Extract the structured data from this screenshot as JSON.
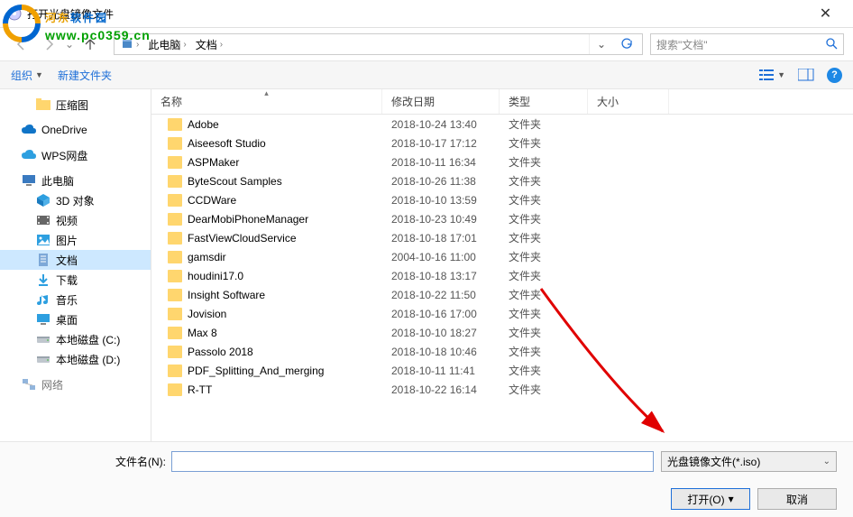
{
  "title": "打开光盘镜像文件",
  "watermark": {
    "text_cn": "河东软件园",
    "url": "www.pc0359.cn"
  },
  "nav": {
    "crumbs": [
      "此电脑",
      "文档"
    ],
    "search_placeholder": "搜索\"文档\""
  },
  "toolbar": {
    "organize": "组织",
    "newfolder": "新建文件夹"
  },
  "sidebar": {
    "top": [
      {
        "label": "压缩图",
        "color": "#ffd66e",
        "ic": "fold"
      }
    ],
    "cloud": [
      {
        "label": "OneDrive",
        "color": "#1074c7",
        "ic": "cloud"
      },
      {
        "label": "WPS网盘",
        "color": "#2d9fe0",
        "ic": "cloud"
      }
    ],
    "pc_label": "此电脑",
    "pc": [
      {
        "label": "3D 对象",
        "color": "#2d9fe0",
        "ic": "cube"
      },
      {
        "label": "视频",
        "color": "#666",
        "ic": "vid"
      },
      {
        "label": "图片",
        "color": "#2d9fe0",
        "ic": "pic"
      },
      {
        "label": "文档",
        "color": "#2d9fe0",
        "ic": "doc",
        "selected": true
      },
      {
        "label": "下载",
        "color": "#2d9fe0",
        "ic": "dl"
      },
      {
        "label": "音乐",
        "color": "#2d9fe0",
        "ic": "mus"
      },
      {
        "label": "桌面",
        "color": "#2d9fe0",
        "ic": "desk"
      },
      {
        "label": "本地磁盘 (C:)",
        "color": "#9aa4ad",
        "ic": "drive"
      },
      {
        "label": "本地磁盘 (D:)",
        "color": "#9aa4ad",
        "ic": "drive"
      }
    ],
    "net_label": "网络"
  },
  "columns": {
    "name": "名称",
    "date": "修改日期",
    "type": "类型",
    "size": "大小"
  },
  "files": [
    {
      "name": "Adobe",
      "date": "2018-10-24 13:40",
      "type": "文件夹"
    },
    {
      "name": "Aiseesoft Studio",
      "date": "2018-10-17 17:12",
      "type": "文件夹"
    },
    {
      "name": "ASPMaker",
      "date": "2018-10-11 16:34",
      "type": "文件夹"
    },
    {
      "name": "ByteScout Samples",
      "date": "2018-10-26 11:38",
      "type": "文件夹"
    },
    {
      "name": "CCDWare",
      "date": "2018-10-10 13:59",
      "type": "文件夹"
    },
    {
      "name": "DearMobiPhoneManager",
      "date": "2018-10-23 10:49",
      "type": "文件夹"
    },
    {
      "name": "FastViewCloudService",
      "date": "2018-10-18 17:01",
      "type": "文件夹"
    },
    {
      "name": "gamsdir",
      "date": "2004-10-16 11:00",
      "type": "文件夹"
    },
    {
      "name": "houdini17.0",
      "date": "2018-10-18 13:17",
      "type": "文件夹"
    },
    {
      "name": "Insight Software",
      "date": "2018-10-22 11:50",
      "type": "文件夹"
    },
    {
      "name": "Jovision",
      "date": "2018-10-16 17:00",
      "type": "文件夹"
    },
    {
      "name": "Max 8",
      "date": "2018-10-10 18:27",
      "type": "文件夹"
    },
    {
      "name": "Passolo 2018",
      "date": "2018-10-18 10:46",
      "type": "文件夹"
    },
    {
      "name": "PDF_Splitting_And_merging",
      "date": "2018-10-11 11:41",
      "type": "文件夹"
    },
    {
      "name": "R-TT",
      "date": "2018-10-22 16:14",
      "type": "文件夹"
    }
  ],
  "bottom": {
    "filename_label": "文件名(N):",
    "filename_value": "",
    "filter": "光盘镜像文件(*.iso)",
    "open": "打开(O)",
    "cancel": "取消"
  }
}
